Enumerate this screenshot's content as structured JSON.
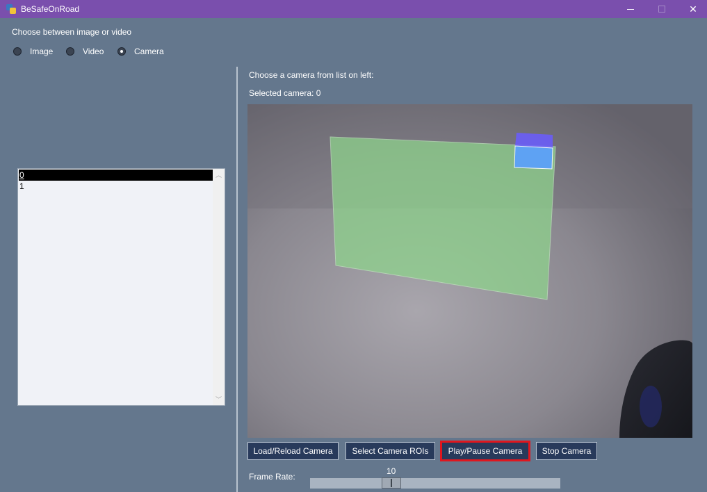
{
  "window": {
    "title": "BeSafeOnRoad"
  },
  "source_choice": {
    "prompt": "Choose between image or video",
    "options": [
      {
        "label": "Image",
        "checked": false
      },
      {
        "label": "Video",
        "checked": false
      },
      {
        "label": "Camera",
        "checked": true
      }
    ]
  },
  "camera_list": {
    "items": [
      "0",
      "1"
    ],
    "selected_index": 0
  },
  "camera_panel": {
    "instruction": "Choose a camera from list on left:",
    "selected_text": "Selected camera: 0"
  },
  "buttons": {
    "load": "Load/Reload Camera",
    "select_rois": "Select Camera ROIs",
    "play_pause": "Play/Pause Camera",
    "stop": "Stop Camera"
  },
  "frame_rate": {
    "label": "Frame Rate:",
    "value": "10",
    "fraction": 0.28
  },
  "colors": {
    "background": "#64778d",
    "titlebar": "#7a4fad",
    "button": "#283a5b",
    "highlight_border": "#e0161e",
    "roi_green": "#88c98a",
    "roi_blue": "#6a8cff"
  },
  "icons": [
    "app-icon",
    "minimize-icon",
    "maximize-icon",
    "close-icon",
    "chevron-up-icon",
    "chevron-down-icon"
  ]
}
